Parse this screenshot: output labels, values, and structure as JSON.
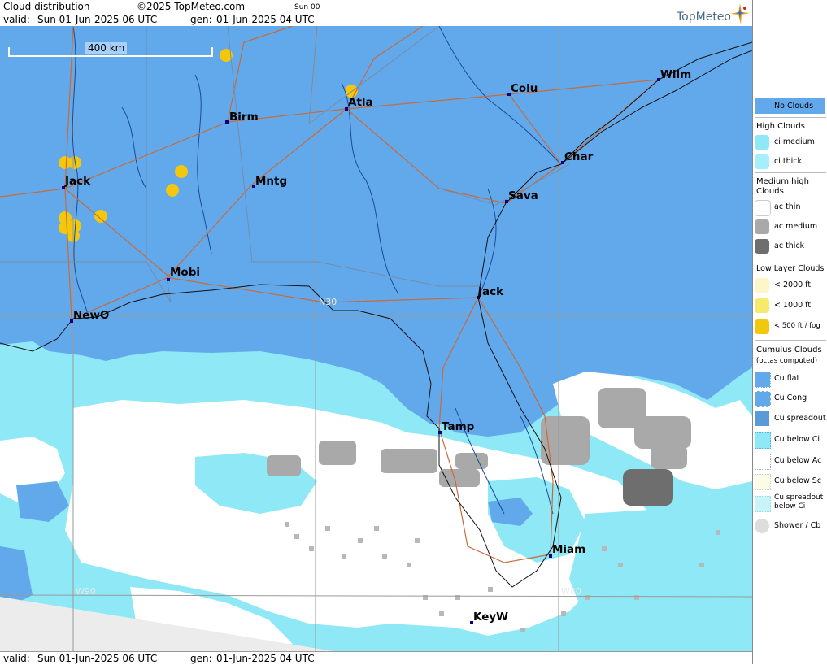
{
  "header": {
    "title": "Cloud distribution",
    "copyright": "©2025 TopMeteo.com",
    "run_label": "Sun 00",
    "valid_label": "valid:",
    "valid_value": "Sun  01-Jun-2025  06 UTC",
    "gen_label": "gen:",
    "gen_value": "01-Jun-2025 04 UTC",
    "logo": "TopMeteo"
  },
  "footer": {
    "valid_label": "valid:",
    "valid_value": "Sun  01-Jun-2025  06 UTC",
    "gen_label": "gen:",
    "gen_value": "01-Jun-2025 04 UTC"
  },
  "map": {
    "scale_label": "400 km",
    "grid_labels": {
      "n30": "N30",
      "w90": "W90",
      "w80": "W80"
    },
    "cities": [
      {
        "id": "jack-ms",
        "name": "Jack"
      },
      {
        "id": "birm",
        "name": "Birm"
      },
      {
        "id": "atla",
        "name": "Atla"
      },
      {
        "id": "colu",
        "name": "Colu"
      },
      {
        "id": "wilm",
        "name": "Wilm"
      },
      {
        "id": "mntg",
        "name": "Mntg"
      },
      {
        "id": "char",
        "name": "Char"
      },
      {
        "id": "sava",
        "name": "Sava"
      },
      {
        "id": "mobi",
        "name": "Mobi"
      },
      {
        "id": "jack-fl",
        "name": "Jack"
      },
      {
        "id": "newo",
        "name": "NewO"
      },
      {
        "id": "tamp",
        "name": "Tamp"
      },
      {
        "id": "miam",
        "name": "Miam"
      },
      {
        "id": "keyw",
        "name": "KeyW"
      }
    ],
    "colors": {
      "no_clouds": "#62a9ec",
      "ci_medium": "#8fe8f5",
      "ci_thick": "#a4f0fa",
      "ac_thin": "#ffffff",
      "ac_medium": "#a9a9a9",
      "ac_thick": "#6e6e6e",
      "low_1000": "#f2c70d",
      "outside": "#ececec",
      "roads": "#c86a3a",
      "rivers": "#1a4a9a"
    }
  },
  "legend": {
    "no_clouds": "No Clouds",
    "high_header": "High Clouds",
    "ci_medium": "ci medium",
    "ci_thick": "ci thick",
    "medium_header": "Medium high Clouds",
    "ac_thin": "ac thin",
    "ac_medium": "ac medium",
    "ac_thick": "ac thick",
    "low_header": "Low Layer Clouds",
    "low_2000": "< 2000 ft",
    "low_1000": "< 1000 ft",
    "low_500": "< 500 ft / fog",
    "cu_header": "Cumulus Clouds",
    "cu_sub": "(octas computed)",
    "cu_flat": "Cu flat",
    "cu_cong": "Cu Cong",
    "cu_spread": "Cu spreadout",
    "cu_below_ci": "Cu below Ci",
    "cu_below_ac": "Cu below Ac",
    "cu_below_sc": "Cu below Sc",
    "cu_spread_ci": "Cu spreadout below Ci",
    "shower": "Shower / Cb"
  }
}
